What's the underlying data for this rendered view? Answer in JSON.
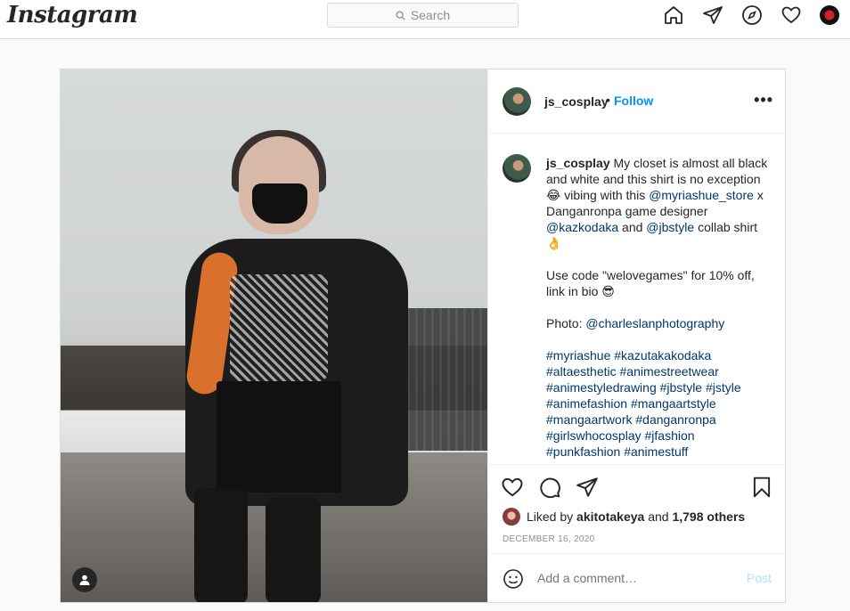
{
  "nav": {
    "logo": "Instagram",
    "search_placeholder": "Search",
    "icons": [
      "home-icon",
      "direct-icon",
      "explore-icon",
      "activity-icon",
      "profile-avatar"
    ]
  },
  "post": {
    "username": "js_cosplay",
    "separator": "•",
    "follow_label": "Follow",
    "more_label": "•••",
    "caption": {
      "username": "js_cosplay",
      "text_1": " My closet is almost all black and white and this shirt is no exception 😂 vibing with this ",
      "mention_1": "@myriashue_store",
      "text_2": " x Danganronpa game designer ",
      "mention_2": "@kazkodaka",
      "text_3": " and ",
      "mention_3": "@jbstyle",
      "text_4": " collab shirt 👌",
      "paragraph_2": "Use code \"welovegames\" for 10% off, link in bio 😎",
      "photo_label": "Photo: ",
      "photo_mention": "@charleslanphotography",
      "hashtags": [
        "#myriashue",
        "#kazutakakodaka",
        "#altaesthetic",
        "#animestreetwear",
        "#animestyledrawing",
        "#jbstyle",
        "#jstyle",
        "#animefashion",
        "#mangaartstyle",
        "#mangaartwork",
        "#danganronpa",
        "#girlswhocosplay",
        "#jfashion",
        "#punkfashion",
        "#animestuff"
      ]
    },
    "likes": {
      "prefix": "Liked by ",
      "user": "akitotakeya",
      "middle": " and ",
      "others": "1,798 others"
    },
    "date": "DECEMBER 16, 2020",
    "comment_placeholder": "Add a comment…",
    "post_label": "Post"
  }
}
